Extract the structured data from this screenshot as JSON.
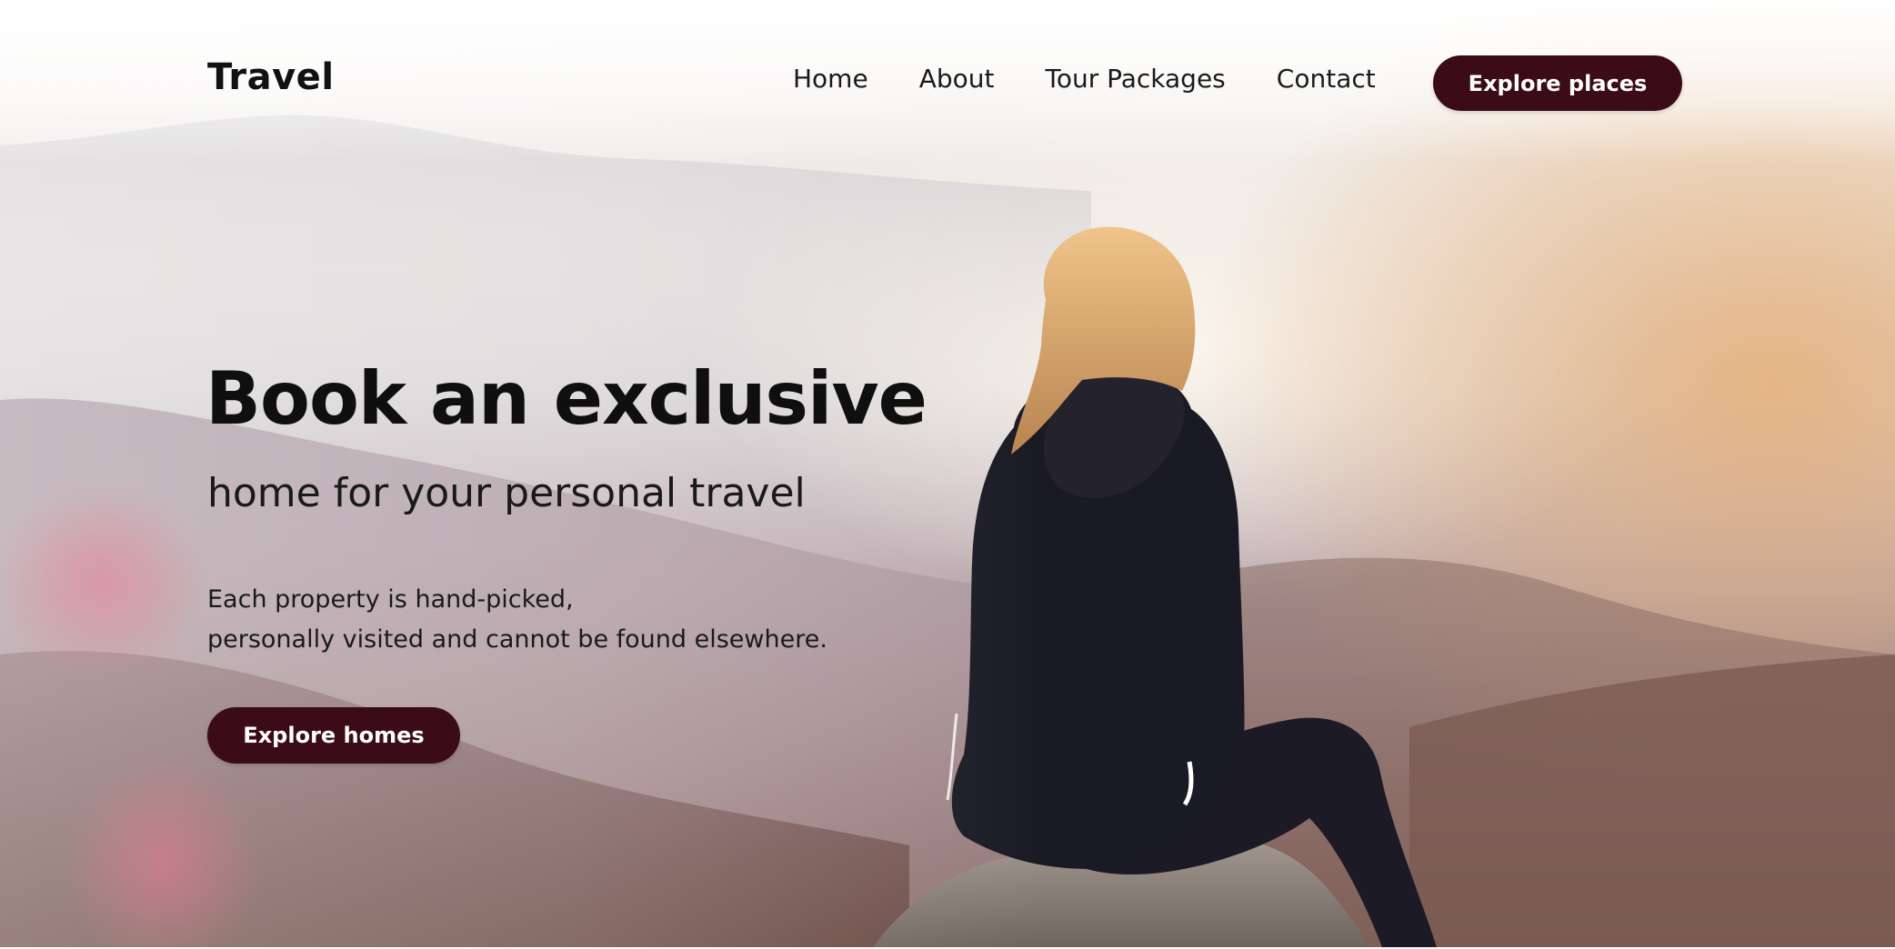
{
  "brand": {
    "name": "Travel"
  },
  "nav": {
    "items": [
      {
        "label": "Home"
      },
      {
        "label": "About"
      },
      {
        "label": "Tour Packages"
      },
      {
        "label": "Contact"
      }
    ],
    "cta_label": "Explore places"
  },
  "hero": {
    "headline": "Book an exclusive",
    "subheadline": "home for your personal travel",
    "description_lines": [
      "Each property is hand-picked,",
      "personally visited and cannot be found elsewhere."
    ],
    "cta_label": "Explore homes"
  },
  "colors": {
    "accent": "#3b0c16",
    "text": "#111111"
  }
}
